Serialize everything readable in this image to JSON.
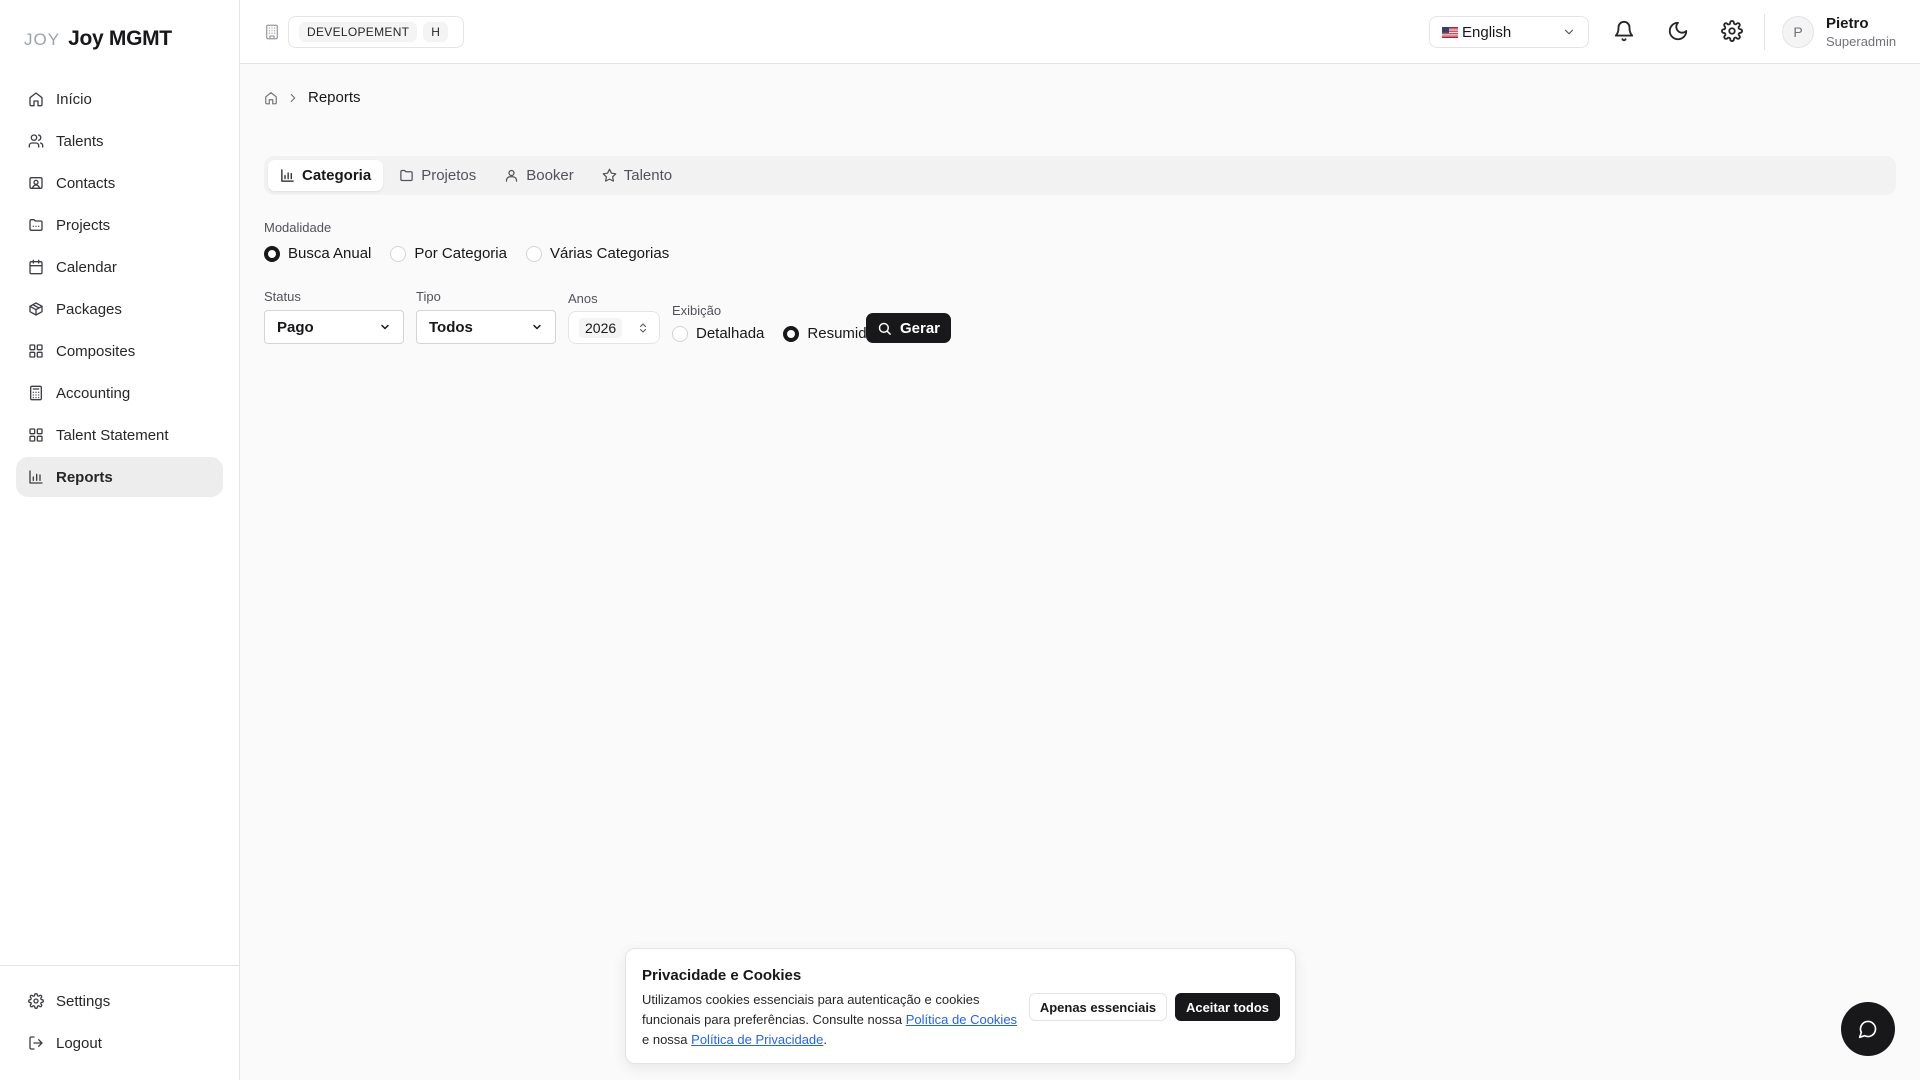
{
  "app": {
    "logo_mark": "JOY",
    "name": "Joy MGMT"
  },
  "sidebar": {
    "items": [
      {
        "label": "Início",
        "icon": "home-icon"
      },
      {
        "label": "Talents",
        "icon": "users-icon"
      },
      {
        "label": "Contacts",
        "icon": "contact-card-icon"
      },
      {
        "label": "Projects",
        "icon": "folder-icon"
      },
      {
        "label": "Calendar",
        "icon": "calendar-icon"
      },
      {
        "label": "Packages",
        "icon": "package-icon"
      },
      {
        "label": "Composites",
        "icon": "grid-icon"
      },
      {
        "label": "Accounting",
        "icon": "calculator-icon"
      },
      {
        "label": "Talent Statement",
        "icon": "grid-icon"
      },
      {
        "label": "Reports",
        "icon": "bar-chart-icon",
        "active": true
      }
    ],
    "bottom": [
      {
        "label": "Settings",
        "icon": "gear-icon"
      },
      {
        "label": "Logout",
        "icon": "logout-icon"
      }
    ]
  },
  "topbar": {
    "environment": "DEVELOPEMENT",
    "environment_short": "H",
    "language": "English",
    "user": {
      "initial": "P",
      "name": "Pietro",
      "role": "Superadmin"
    }
  },
  "breadcrumb": {
    "current": "Reports"
  },
  "tabs": [
    {
      "label": "Categoria",
      "icon": "bar-chart-icon",
      "active": true
    },
    {
      "label": "Projetos",
      "icon": "folder-icon"
    },
    {
      "label": "Booker",
      "icon": "user-icon"
    },
    {
      "label": "Talento",
      "icon": "star-icon"
    }
  ],
  "form": {
    "modalidade": {
      "label": "Modalidade",
      "options": [
        "Busca Anual",
        "Por Categoria",
        "Várias Categorias"
      ],
      "selected": "Busca Anual"
    },
    "status": {
      "label": "Status",
      "value": "Pago"
    },
    "tipo": {
      "label": "Tipo",
      "value": "Todos"
    },
    "anos": {
      "label": "Anos",
      "value": "2026"
    },
    "exibicao": {
      "label": "Exibição",
      "options": [
        "Detalhada",
        "Resumida"
      ],
      "selected": "Resumida"
    },
    "submit_label": "Gerar"
  },
  "cookie_banner": {
    "title": "Privacidade e Cookies",
    "text_part1": "Utilizamos cookies essenciais para autenticação e cookies funcionais para preferências. Consulte nossa ",
    "cookie_policy_link": "Política de Cookies",
    "text_part2": " e nossa ",
    "privacy_policy_link": "Política de Privacidade",
    "text_part3": ".",
    "essential_button": "Apenas essenciais",
    "accept_button": "Aceitar todos"
  },
  "colors": {
    "primary": "#18181b",
    "link": "#2563eb",
    "background": "#fafafa",
    "active_nav": "#ededee"
  }
}
